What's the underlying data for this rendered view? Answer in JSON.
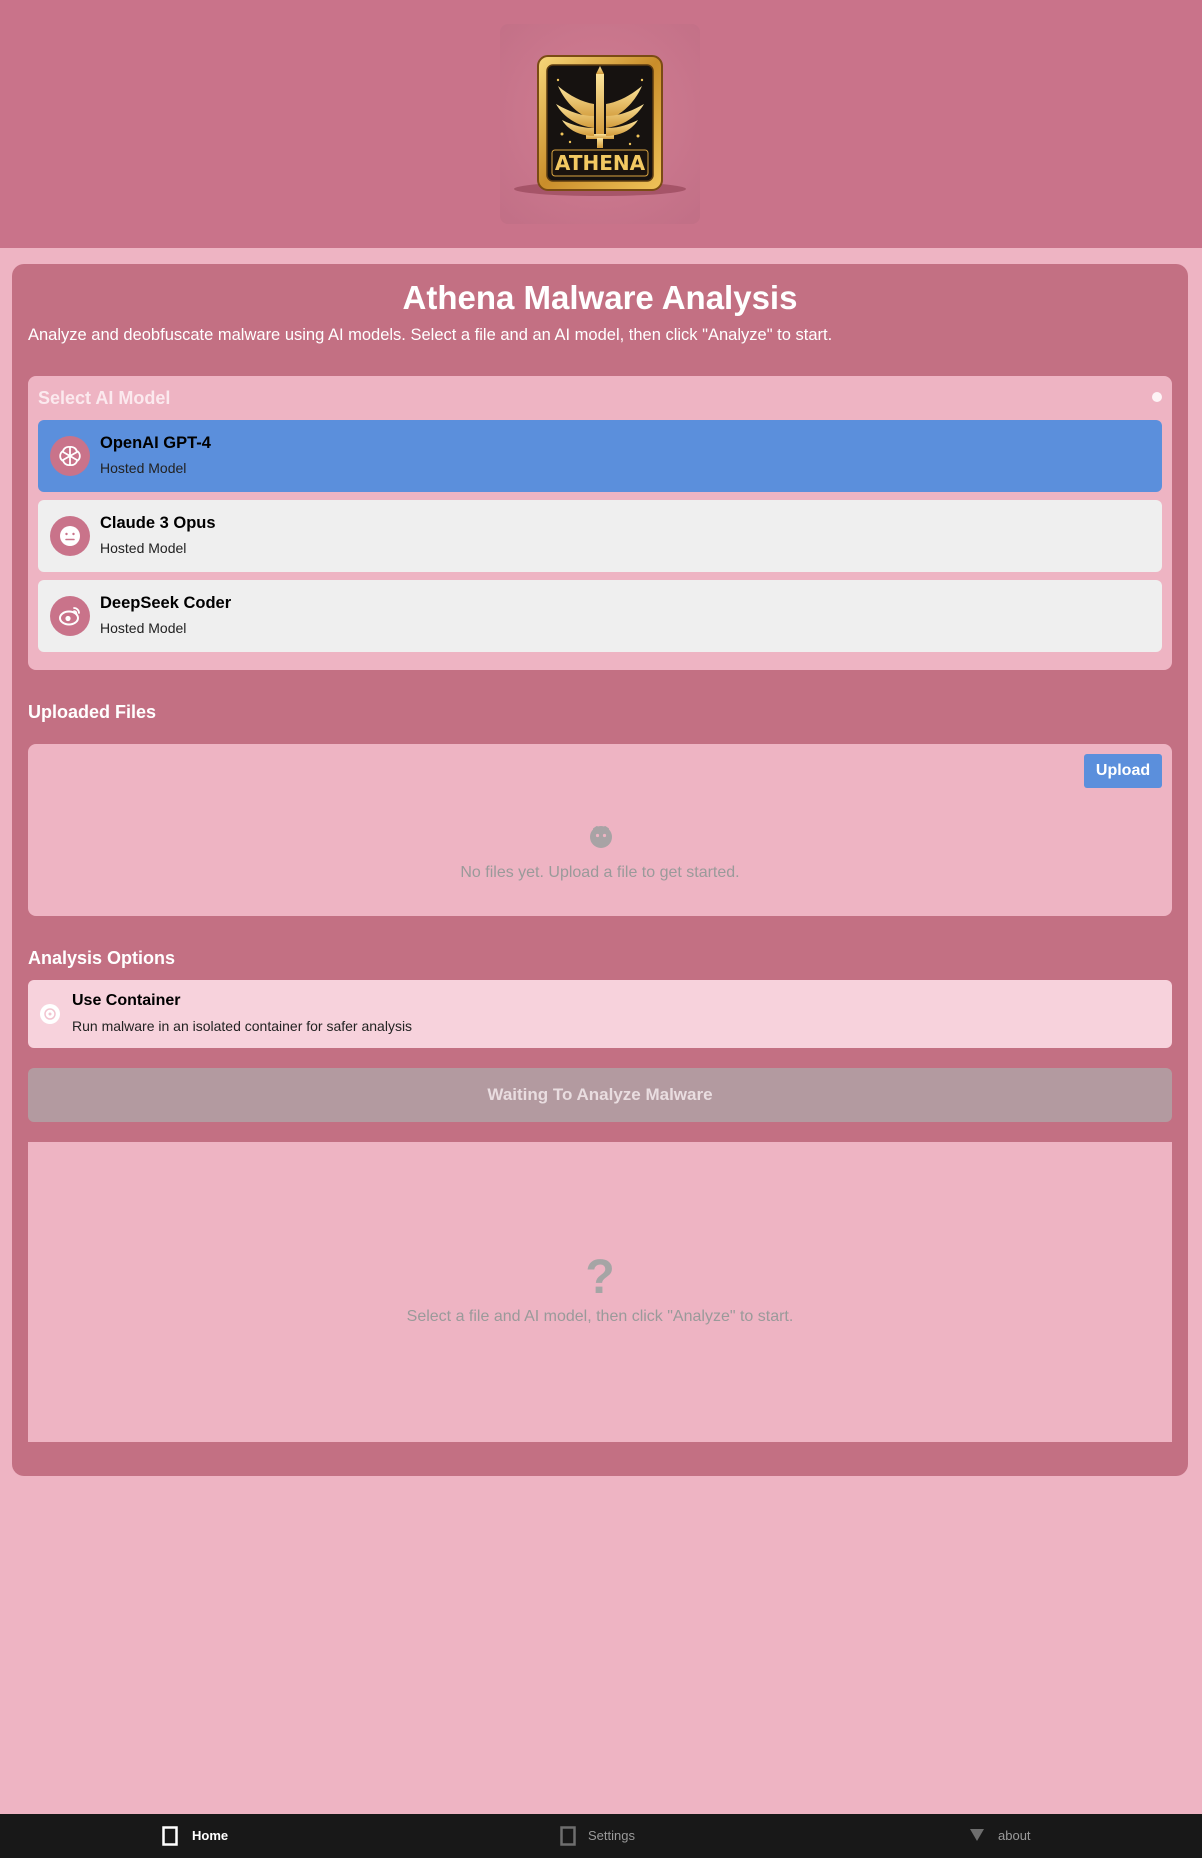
{
  "header": {
    "logo_text": "ATHENA",
    "logo_icon": "athena-shield-logo"
  },
  "main": {
    "title": "Athena Malware Analysis",
    "subtitle": "Analyze and deobfuscate malware using AI models. Select a file and an AI model, then click \"Analyze\" to start."
  },
  "model_select": {
    "heading": "Select AI Model",
    "models": [
      {
        "name": "OpenAI GPT-4",
        "type": "Hosted Model",
        "icon": "openai-icon",
        "selected": true
      },
      {
        "name": "Claude 3 Opus",
        "type": "Hosted Model",
        "icon": "claude-face-icon",
        "selected": false
      },
      {
        "name": "DeepSeek Coder",
        "type": "Hosted Model",
        "icon": "deepseek-icon",
        "selected": false
      }
    ]
  },
  "files": {
    "heading": "Uploaded Files",
    "upload_label": "Upload",
    "empty_icon": "empty-face-icon",
    "empty_text": "No files yet. Upload a file to get started."
  },
  "options": {
    "heading": "Analysis Options",
    "container_title": "Use Container",
    "container_desc": "Run malware in an isolated container for safer analysis",
    "container_enabled": false
  },
  "analyze": {
    "button_label": "Waiting To Analyze Malware",
    "enabled": false
  },
  "results": {
    "icon": "?",
    "empty_text": "Select a file and AI model, then click \"Analyze\" to start."
  },
  "nav": {
    "items": [
      {
        "label": "Home",
        "icon": "home-icon",
        "active": true
      },
      {
        "label": "Settings",
        "icon": "settings-icon",
        "active": false
      },
      {
        "label": "about",
        "icon": "about-icon",
        "active": false
      }
    ]
  },
  "colors": {
    "header_bg": "#c9738a",
    "page_bg": "#eeb4c3",
    "card_bg": "#c37083",
    "selected_accent": "#5b8fdc",
    "nav_bg": "#181818"
  }
}
